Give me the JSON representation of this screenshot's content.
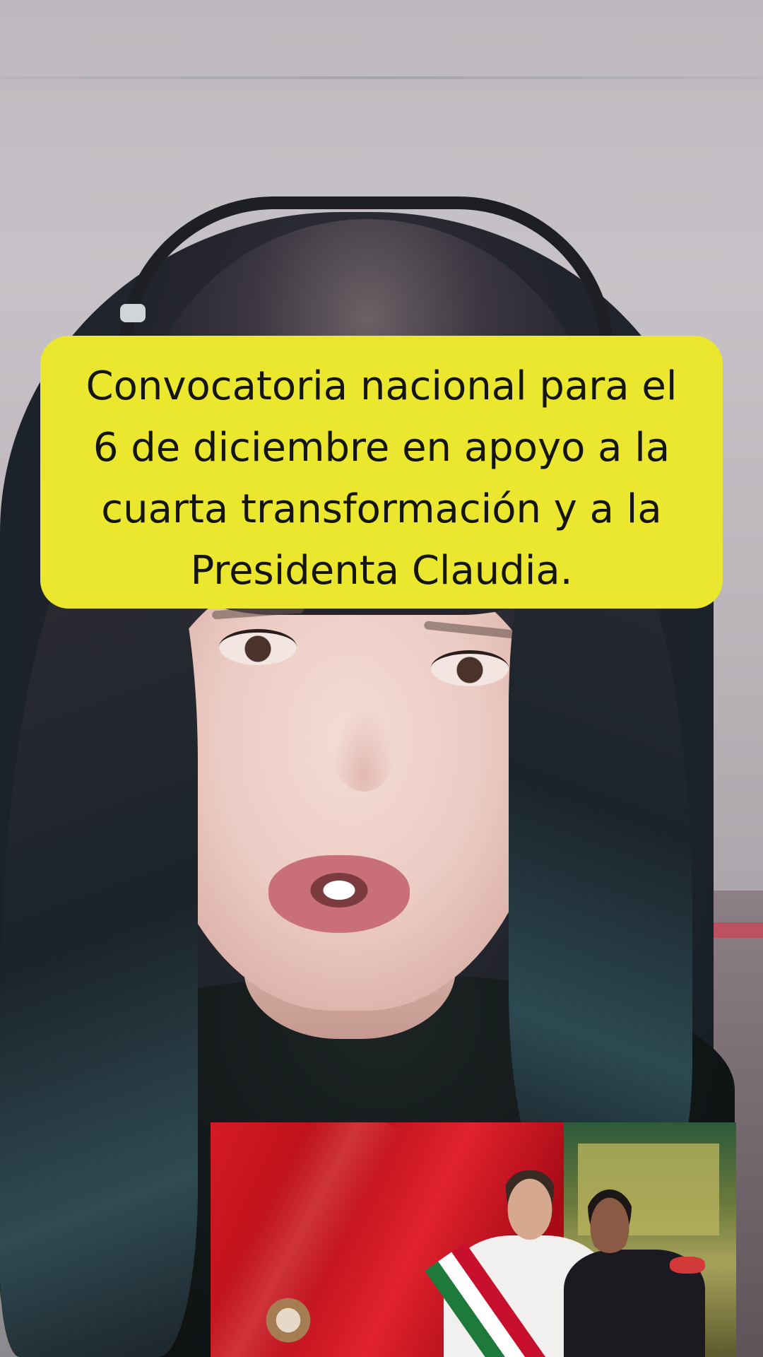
{
  "caption": {
    "lines": [
      "Convocatoria nacional para el",
      "6 de diciembre en apoyo a la",
      "cuarta transformación y a la",
      "Presidenta Claudia."
    ]
  },
  "colors": {
    "caption_background": "#ebe62e",
    "caption_text": "#15150f"
  },
  "scene": {
    "main": "woman-speaking-to-camera",
    "inset": "presidential-sash-ceremony-photo"
  }
}
